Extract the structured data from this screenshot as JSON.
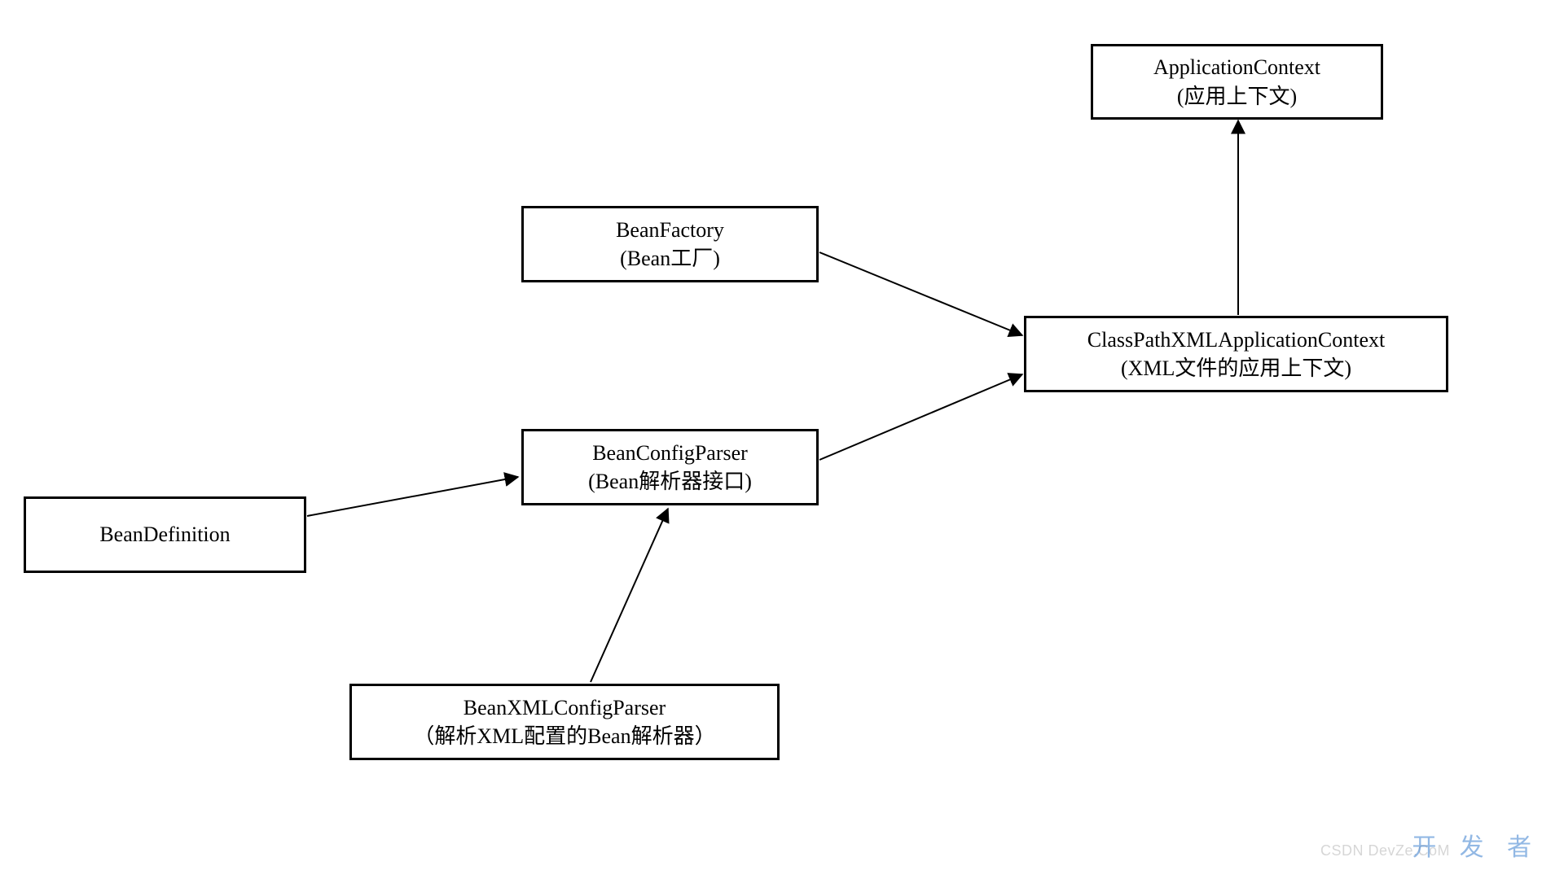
{
  "nodes": {
    "applicationContext": {
      "line1": "ApplicationContext",
      "line2": "(应用上下文)"
    },
    "beanFactory": {
      "line1": "BeanFactory",
      "line2": "(Bean工厂)"
    },
    "classPathXmlApplicationContext": {
      "line1": "ClassPathXMLApplicationContext",
      "line2": "(XML文件的应用上下文)"
    },
    "beanConfigParser": {
      "line1": "BeanConfigParser",
      "line2": "(Bean解析器接口)"
    },
    "beanDefinition": {
      "line1": "BeanDefinition"
    },
    "beanXmlConfigParser": {
      "line1": "BeanXMLConfigParser",
      "line2": "（解析XML配置的Bean解析器）"
    }
  },
  "edges": [
    {
      "from": "beanFactory",
      "to": "classPathXmlApplicationContext"
    },
    {
      "from": "beanConfigParser",
      "to": "classPathXmlApplicationContext"
    },
    {
      "from": "classPathXmlApplicationContext",
      "to": "applicationContext"
    },
    {
      "from": "beanDefinition",
      "to": "beanConfigParser"
    },
    {
      "from": "beanXmlConfigParser",
      "to": "beanConfigParser"
    }
  ],
  "watermarks": {
    "brand": "开 发 者",
    "csdn": "CSDN DevZe.CoM"
  }
}
